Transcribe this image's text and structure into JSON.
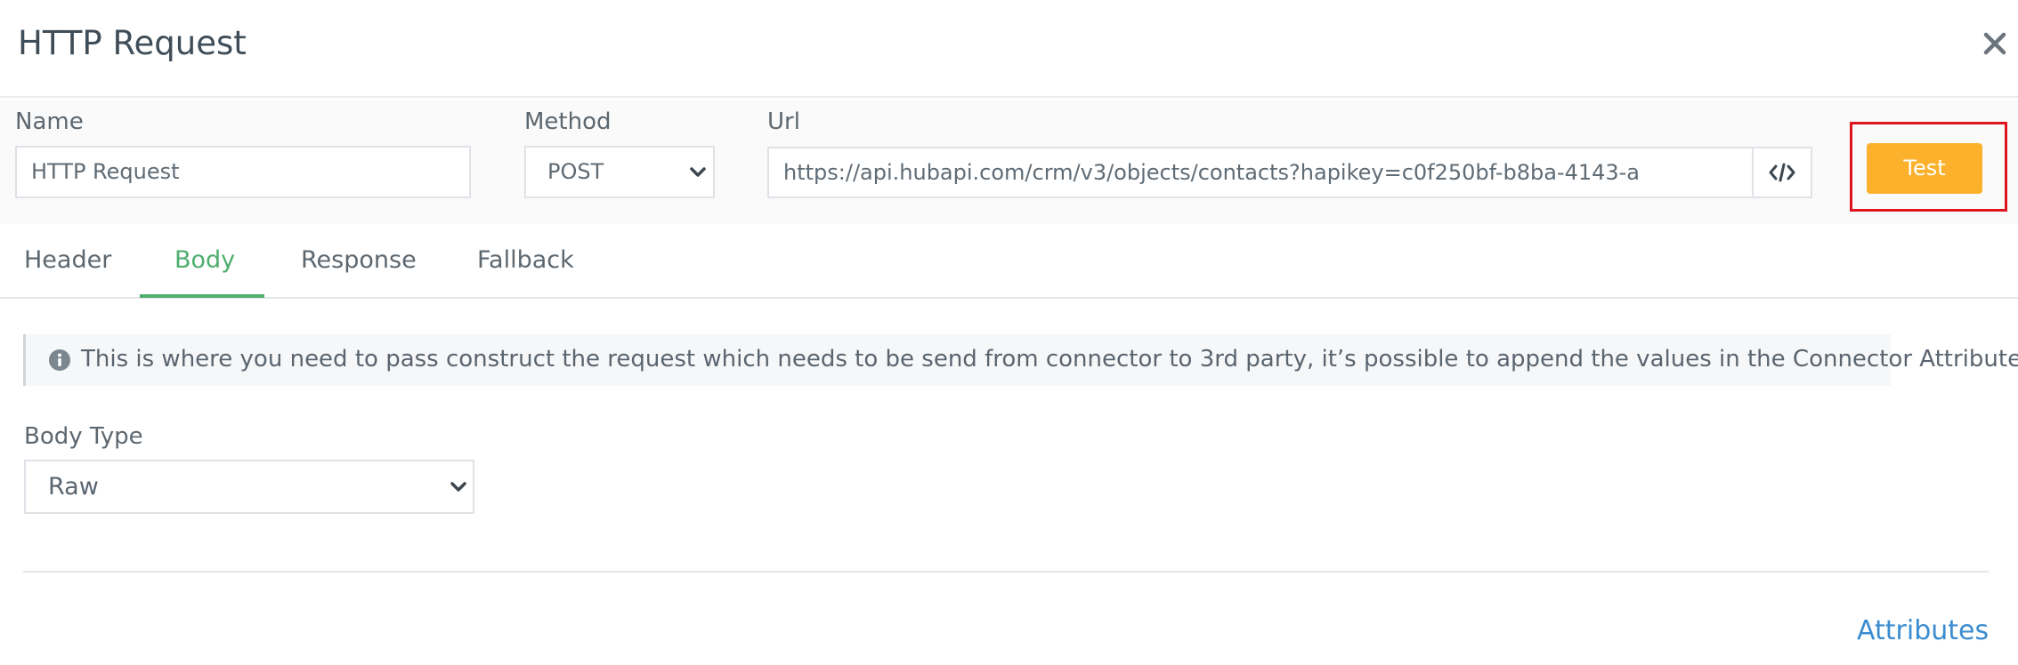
{
  "modal": {
    "title": "HTTP Request"
  },
  "form": {
    "name_label": "Name",
    "name_value": "HTTP Request",
    "method_label": "Method",
    "method_value": "POST",
    "url_label": "Url",
    "url_value": "https://api.hubapi.com/crm/v3/objects/contacts?hapikey=c0f250bf-b8ba-4143-a",
    "test_label": "Test"
  },
  "tabs": [
    {
      "label": "Header",
      "active": false
    },
    {
      "label": "Body",
      "active": true
    },
    {
      "label": "Response",
      "active": false
    },
    {
      "label": "Fallback",
      "active": false
    }
  ],
  "body": {
    "info_text": "This is where you need to pass construct the request which needs to be send from connector to 3rd party, it’s possible to append the values in the Connector Attribute",
    "body_type_label": "Body Type",
    "body_type_value": "Raw"
  },
  "footer": {
    "attributes_label": "Attributes"
  },
  "icons": {
    "close": "close-icon",
    "code": "code-icon",
    "info": "info-circle-icon",
    "chevron": "chevron-down-icon"
  },
  "colors": {
    "accent_green": "#4fae6e",
    "test_button": "#fcb12c",
    "highlight_red": "#e0141e",
    "link_blue": "#3c8dd0"
  }
}
